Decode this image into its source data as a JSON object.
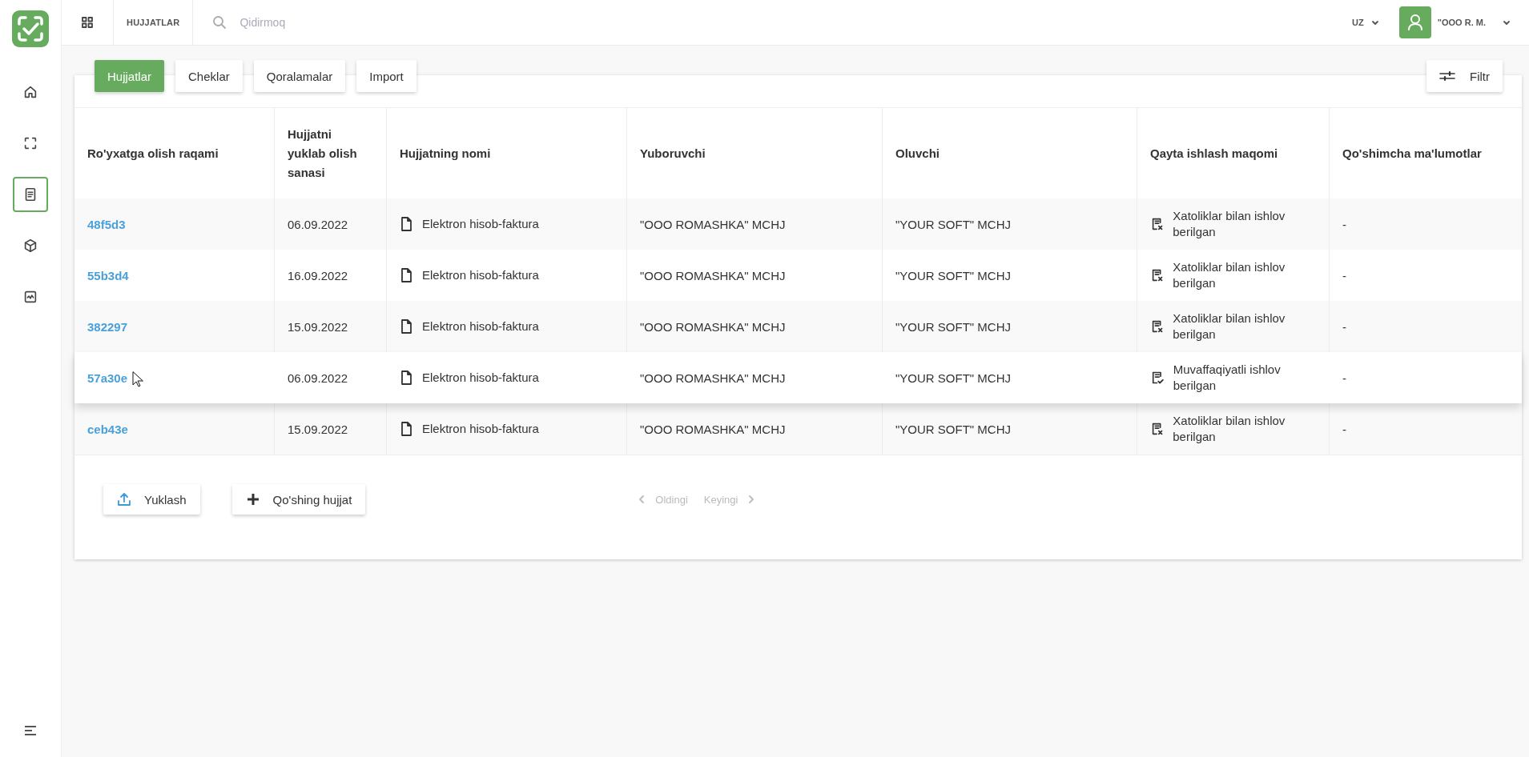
{
  "sidebar": {
    "items": [
      {
        "kind": "home",
        "selected": false
      },
      {
        "kind": "scan",
        "selected": false
      },
      {
        "kind": "document",
        "selected": true
      },
      {
        "kind": "cube",
        "selected": false
      },
      {
        "kind": "chart",
        "selected": false
      }
    ]
  },
  "topbar": {
    "section_title": "HUJJATLAR",
    "search": {
      "placeholder": "Qidirmoq"
    },
    "language": "UZ",
    "user": "\"OOO R. M."
  },
  "tabs": [
    {
      "label": "Hujjatlar",
      "selected": true
    },
    {
      "label": "Cheklar",
      "selected": false
    },
    {
      "label": "Qoralamalar",
      "selected": false
    },
    {
      "label": "Import",
      "selected": false
    }
  ],
  "filter_button": "Filtr",
  "table": {
    "columns": [
      "Ro'yxatga olish raqami",
      "Hujjatni yuklab olish sanasi",
      "Hujjatning nomi",
      "Yuboruvchi",
      "Oluvchi",
      "Qayta ishlash maqomi",
      "Qo'shimcha ma'lumotlar"
    ],
    "rows": [
      {
        "number": "48f5d3",
        "date": "06.09.2022",
        "name": "Elektron hisob-faktura",
        "sender": "\"OOO ROMASHKA\" MCHJ",
        "receiver": "\"YOUR SOFT\" MCHJ",
        "status": {
          "kind": "error",
          "text": "Xatoliklar bilan ishlov berilgan"
        },
        "extra": "-",
        "hovered": false
      },
      {
        "number": "55b3d4",
        "date": "16.09.2022",
        "name": "Elektron hisob-faktura",
        "sender": "\"OOO ROMASHKA\" MCHJ",
        "receiver": "\"YOUR SOFT\" MCHJ",
        "status": {
          "kind": "error",
          "text": "Xatoliklar bilan ishlov berilgan"
        },
        "extra": "-",
        "hovered": false
      },
      {
        "number": "382297",
        "date": "15.09.2022",
        "name": "Elektron hisob-faktura",
        "sender": "\"OOO ROMASHKA\" MCHJ",
        "receiver": "\"YOUR SOFT\" MCHJ",
        "status": {
          "kind": "error",
          "text": "Xatoliklar bilan ishlov berilgan"
        },
        "extra": "-",
        "hovered": false
      },
      {
        "number": "57a30e",
        "date": "06.09.2022",
        "name": "Elektron hisob-faktura",
        "sender": "\"OOO ROMASHKA\" MCHJ",
        "receiver": "\"YOUR SOFT\" MCHJ",
        "status": {
          "kind": "success",
          "text": "Muvaffaqiyatli ishlov berilgan"
        },
        "extra": "-",
        "hovered": true
      },
      {
        "number": "ceb43e",
        "date": "15.09.2022",
        "name": "Elektron hisob-faktura",
        "sender": "\"OOO ROMASHKA\" MCHJ",
        "receiver": "\"YOUR SOFT\" MCHJ",
        "status": {
          "kind": "error",
          "text": "Xatoliklar bilan ishlov berilgan"
        },
        "extra": "-",
        "hovered": false
      }
    ]
  },
  "actions": [
    {
      "kind": "upload",
      "label": "Yuklash"
    },
    {
      "kind": "add",
      "label": "Qo'shing hujjat"
    }
  ],
  "pagination": {
    "previous": {
      "label": "Oldingi",
      "disabled": true
    },
    "next": {
      "label": "Keyingi",
      "disabled": true
    }
  }
}
